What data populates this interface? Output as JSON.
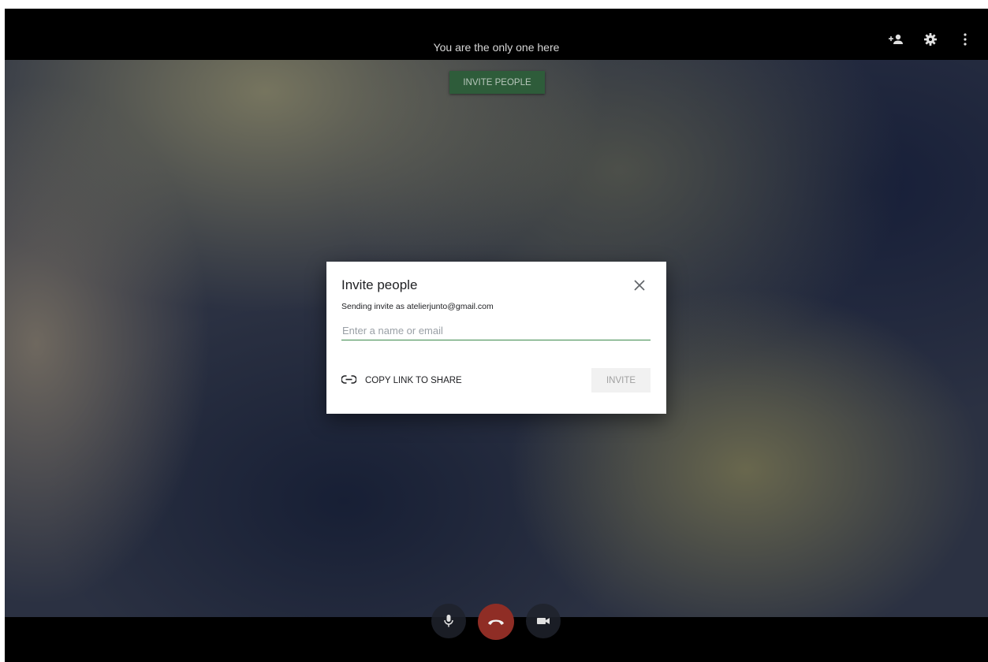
{
  "topbar": {
    "status_text": "You are the only one here",
    "icons": [
      "add-person-icon",
      "gear-icon",
      "more-vert-icon"
    ]
  },
  "main": {
    "invite_button_label": "INVITE PEOPLE"
  },
  "dialog": {
    "title": "Invite people",
    "subtitle": "Sending invite as atelierjunto@gmail.com",
    "input_value": "",
    "input_placeholder": "Enter a name or email",
    "copy_link_label": "COPY LINK TO SHARE",
    "invite_label": "INVITE",
    "close_icon": "close-icon",
    "link_icon": "link-icon"
  },
  "controls": {
    "icons": [
      "microphone-icon",
      "hang-up-icon",
      "camera-icon"
    ]
  },
  "colors": {
    "accent_green": "#2e5c3a",
    "input_underline": "#3c8a4c",
    "hangup_red": "#8f2d25"
  }
}
